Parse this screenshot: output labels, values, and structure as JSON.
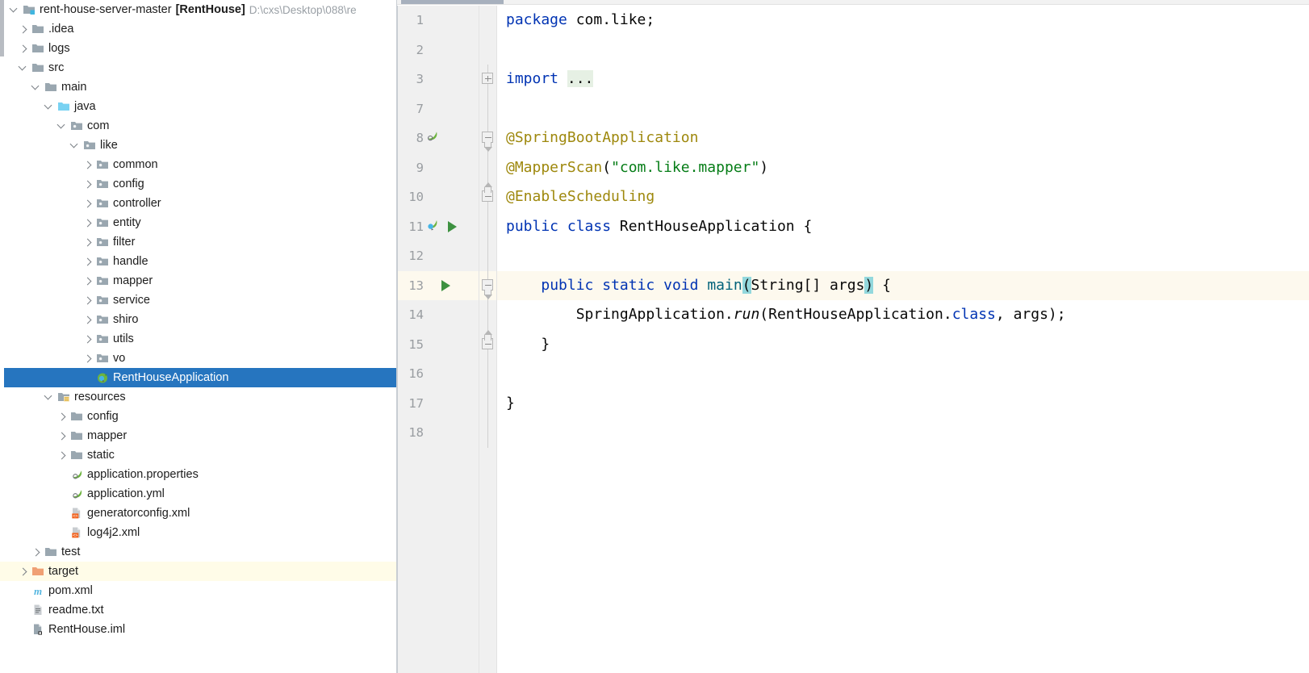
{
  "project": {
    "root": {
      "name": "rent-house-server-master",
      "module": "[RentHouse]",
      "path": "D:\\cxs\\Desktop\\088\\re"
    },
    "tree": [
      {
        "label": ".idea",
        "indent": 1,
        "arrow": "closed",
        "icon": "folder-grey"
      },
      {
        "label": "logs",
        "indent": 1,
        "arrow": "closed",
        "icon": "folder-grey"
      },
      {
        "label": "src",
        "indent": 1,
        "arrow": "open",
        "icon": "folder-grey"
      },
      {
        "label": "main",
        "indent": 2,
        "arrow": "open",
        "icon": "folder-grey"
      },
      {
        "label": "java",
        "indent": 3,
        "arrow": "open",
        "icon": "folder-source-blue"
      },
      {
        "label": "com",
        "indent": 4,
        "arrow": "open",
        "icon": "folder-package"
      },
      {
        "label": "like",
        "indent": 5,
        "arrow": "open",
        "icon": "folder-package"
      },
      {
        "label": "common",
        "indent": 6,
        "arrow": "closed",
        "icon": "folder-package"
      },
      {
        "label": "config",
        "indent": 6,
        "arrow": "closed",
        "icon": "folder-package"
      },
      {
        "label": "controller",
        "indent": 6,
        "arrow": "closed",
        "icon": "folder-package"
      },
      {
        "label": "entity",
        "indent": 6,
        "arrow": "closed",
        "icon": "folder-package"
      },
      {
        "label": "filter",
        "indent": 6,
        "arrow": "closed",
        "icon": "folder-package"
      },
      {
        "label": "handle",
        "indent": 6,
        "arrow": "closed",
        "icon": "folder-package"
      },
      {
        "label": "mapper",
        "indent": 6,
        "arrow": "closed",
        "icon": "folder-package"
      },
      {
        "label": "service",
        "indent": 6,
        "arrow": "closed",
        "icon": "folder-package"
      },
      {
        "label": "shiro",
        "indent": 6,
        "arrow": "closed",
        "icon": "folder-package"
      },
      {
        "label": "utils",
        "indent": 6,
        "arrow": "closed",
        "icon": "folder-package"
      },
      {
        "label": "vo",
        "indent": 6,
        "arrow": "closed",
        "icon": "folder-package"
      },
      {
        "label": "RentHouseApplication",
        "indent": 6,
        "arrow": "none",
        "icon": "spring-boot-class",
        "selected": true
      },
      {
        "label": "resources",
        "indent": 3,
        "arrow": "open",
        "icon": "folder-resources"
      },
      {
        "label": "config",
        "indent": 4,
        "arrow": "closed",
        "icon": "folder-grey"
      },
      {
        "label": "mapper",
        "indent": 4,
        "arrow": "closed",
        "icon": "folder-grey"
      },
      {
        "label": "static",
        "indent": 4,
        "arrow": "closed",
        "icon": "folder-grey"
      },
      {
        "label": "application.properties",
        "indent": 4,
        "arrow": "none",
        "icon": "spring-config"
      },
      {
        "label": "application.yml",
        "indent": 4,
        "arrow": "none",
        "icon": "spring-config"
      },
      {
        "label": "generatorconfig.xml",
        "indent": 4,
        "arrow": "none",
        "icon": "xml-file"
      },
      {
        "label": "log4j2.xml",
        "indent": 4,
        "arrow": "none",
        "icon": "xml-file"
      },
      {
        "label": "test",
        "indent": 2,
        "arrow": "closed",
        "icon": "folder-grey"
      },
      {
        "label": "target",
        "indent": 1,
        "arrow": "closed",
        "icon": "folder-orange",
        "excluded": true
      },
      {
        "label": "pom.xml",
        "indent": 1,
        "arrow": "none",
        "icon": "maven-file"
      },
      {
        "label": "readme.txt",
        "indent": 1,
        "arrow": "none",
        "icon": "text-file"
      },
      {
        "label": "RentHouse.iml",
        "indent": 1,
        "arrow": "none",
        "icon": "iml-file"
      }
    ]
  },
  "editor": {
    "lines": [
      {
        "num": "1",
        "gutter": [],
        "fold": "none"
      },
      {
        "num": "2",
        "gutter": [],
        "fold": "none"
      },
      {
        "num": "3",
        "gutter": [],
        "fold": "plus"
      },
      {
        "num": "7",
        "gutter": [],
        "fold": "none"
      },
      {
        "num": "8",
        "gutter": [
          "spring-leaf-icon"
        ],
        "fold": "minus-down"
      },
      {
        "num": "9",
        "gutter": [],
        "fold": "none"
      },
      {
        "num": "10",
        "gutter": [],
        "fold": "minus-up"
      },
      {
        "num": "11",
        "gutter": [
          "spring-bean-icon",
          "run-icon"
        ],
        "fold": "none"
      },
      {
        "num": "12",
        "gutter": [],
        "fold": "none"
      },
      {
        "num": "13",
        "gutter": [
          "run-icon"
        ],
        "fold": "minus-down",
        "current": true
      },
      {
        "num": "14",
        "gutter": [],
        "fold": "none"
      },
      {
        "num": "15",
        "gutter": [],
        "fold": "minus-up"
      },
      {
        "num": "16",
        "gutter": [],
        "fold": "none"
      },
      {
        "num": "17",
        "gutter": [],
        "fold": "none"
      },
      {
        "num": "18",
        "gutter": [],
        "fold": "none"
      }
    ],
    "code": [
      "package com.like;",
      "",
      "import ...",
      "",
      "@SpringBootApplication",
      "@MapperScan(\"com.like.mapper\")",
      "@EnableScheduling",
      "public class RentHouseApplication {",
      "",
      "    public static void main(String[] args) {",
      "        SpringApplication.run(RentHouseApplication.class, args);",
      "    }",
      "",
      "}",
      ""
    ],
    "colors": {
      "keyword": "#0033b3",
      "annotation": "#9e880d",
      "string": "#067d17",
      "method": "#00627a",
      "text": "#080808",
      "caret_line": "#fdf9ee",
      "folded_placeholder": "#e6f0e4",
      "bracket_match": "#93d8dd",
      "selection": "#2675bf",
      "excluded_row": "#fffce8"
    }
  }
}
